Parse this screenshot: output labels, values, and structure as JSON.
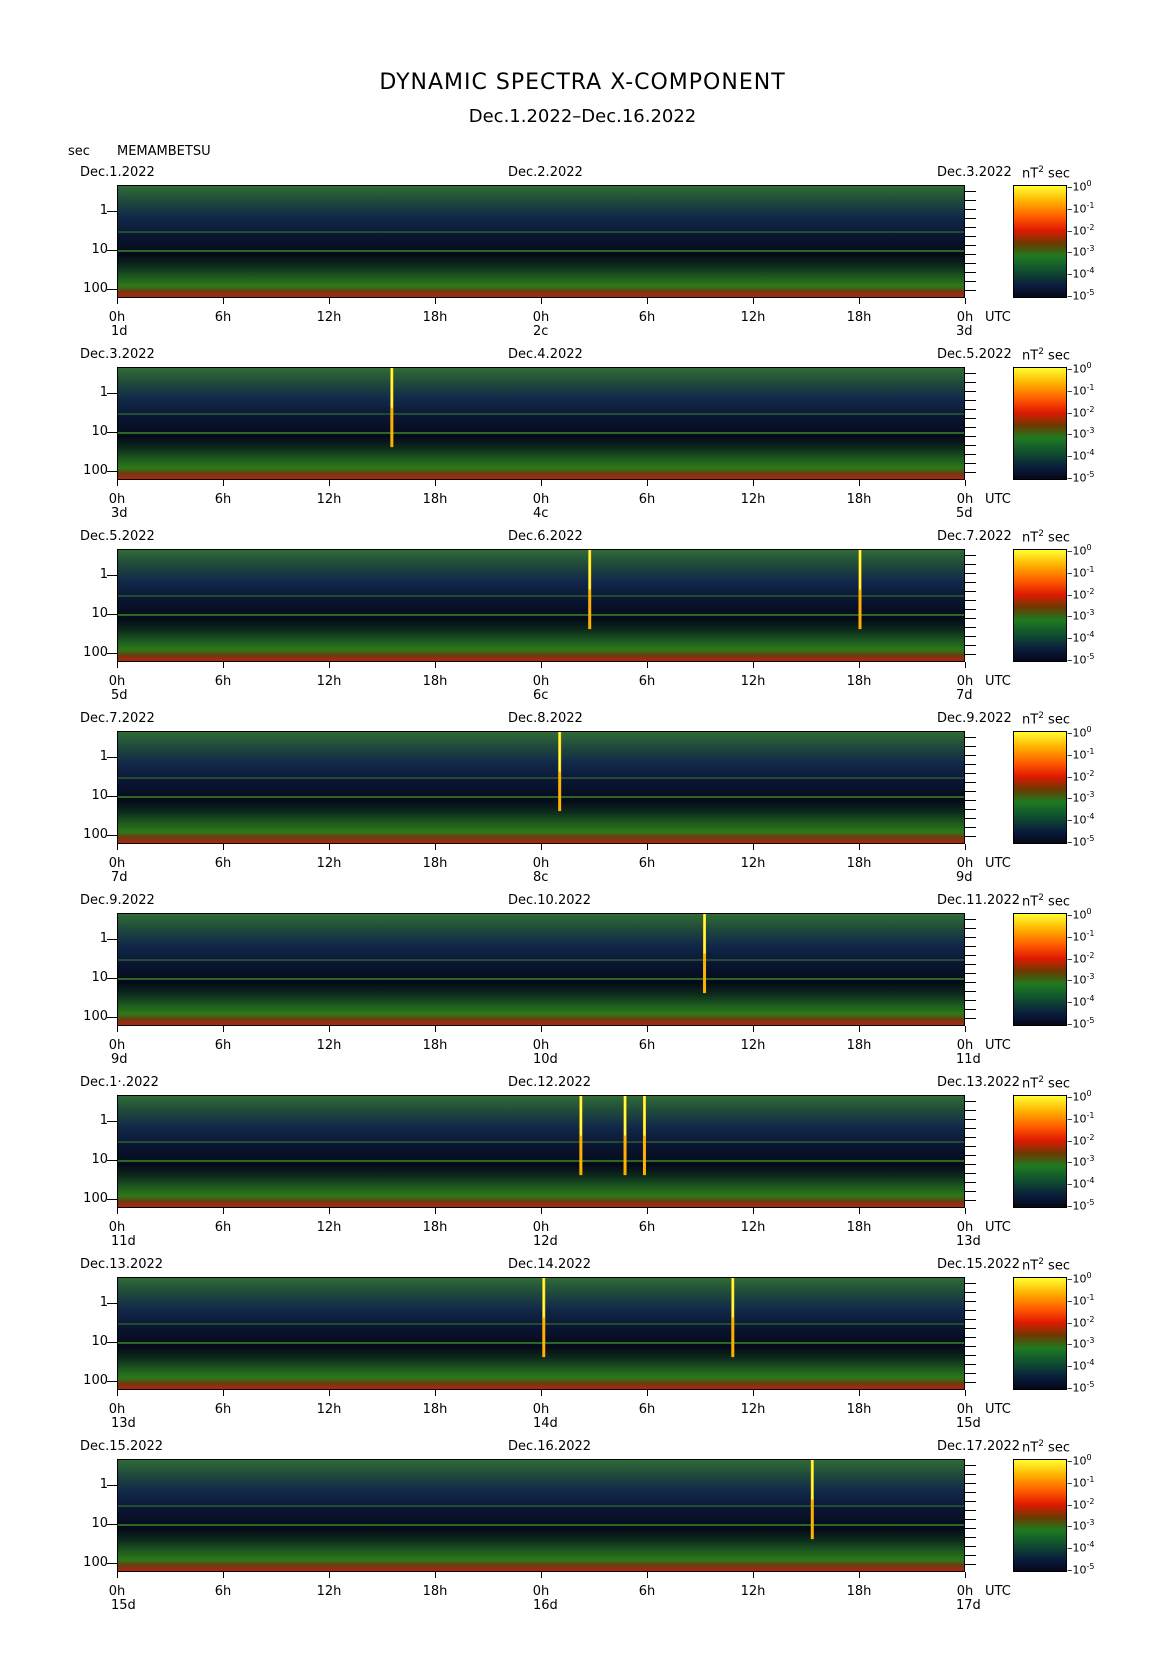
{
  "title": "DYNAMIC SPECTRA X-COMPONENT",
  "subtitle": "Dec.1.2022–Dec.16.2022",
  "header": {
    "yunit": "sec",
    "station": "MEMAMBETSU"
  },
  "colors": {
    "low": "#050818",
    "mid": "#1f7a1f",
    "high": "#e01a00",
    "max": "#ffff30"
  },
  "chart_data": {
    "type": "heatmap",
    "title": "DYNAMIC SPECTRA X-COMPONENT",
    "yaxis": {
      "label": "sec",
      "ticks": [
        "1",
        "10",
        "100"
      ],
      "scale": "log"
    },
    "xaxis": {
      "label": "UTC",
      "ticks": [
        "0h",
        "6h",
        "12h",
        "18h",
        "0h",
        "6h",
        "12h",
        "18h",
        "0h"
      ]
    },
    "colorbar": {
      "unit": "nT",
      "unit_exp": "2",
      "unit_suffix": "sec",
      "ticks": [
        {
          "base": "10",
          "exp": "0"
        },
        {
          "base": "10",
          "exp": "-1"
        },
        {
          "base": "10",
          "exp": "-2"
        },
        {
          "base": "10",
          "exp": "-3"
        },
        {
          "base": "10",
          "exp": "-4"
        },
        {
          "base": "10",
          "exp": "-5"
        }
      ]
    },
    "panels": [
      {
        "left_date": "Dec.1.2022",
        "mid_date": "Dec.2.2022",
        "right_date": "Dec.3.2022",
        "day_start": "1d",
        "day_mid": "2c",
        "day_end": "3d",
        "spikes_hours": []
      },
      {
        "left_date": "Dec.3.2022",
        "mid_date": "Dec.4.2022",
        "right_date": "Dec.5.2022",
        "day_start": "3d",
        "day_mid": "4c",
        "day_end": "5d",
        "spikes_hours": [
          15.5
        ]
      },
      {
        "left_date": "Dec.5.2022",
        "mid_date": "Dec.6.2022",
        "right_date": "Dec.7.2022",
        "day_start": "5d",
        "day_mid": "6c",
        "day_end": "7d",
        "spikes_hours": [
          26.7,
          42.0
        ]
      },
      {
        "left_date": "Dec.7.2022",
        "mid_date": "Dec.8.2022",
        "right_date": "Dec.9.2022",
        "day_start": "7d",
        "day_mid": "8c",
        "day_end": "9d",
        "spikes_hours": [
          25.0
        ]
      },
      {
        "left_date": "Dec.9.2022",
        "mid_date": "Dec.10.2022",
        "right_date": "Dec.11.2022",
        "day_start": "9d",
        "day_mid": "10d",
        "day_end": "11d",
        "spikes_hours": [
          33.2
        ]
      },
      {
        "left_date": "Dec.1·.2022",
        "mid_date": "Dec.12.2022",
        "right_date": "Dec.13.2022",
        "day_start": "11d",
        "day_mid": "12d",
        "day_end": "13d",
        "spikes_hours": [
          26.2,
          28.7,
          29.8
        ]
      },
      {
        "left_date": "Dec.13.2022",
        "mid_date": "Dec.14.2022",
        "right_date": "Dec.15.2022",
        "day_start": "13d",
        "day_mid": "14d",
        "day_end": "15d",
        "spikes_hours": [
          24.1,
          34.8
        ]
      },
      {
        "left_date": "Dec.15.2022",
        "mid_date": "Dec.16.2022",
        "right_date": "Dec.17.2022",
        "day_start": "15d",
        "day_mid": "16d",
        "day_end": "17d",
        "spikes_hours": [
          39.3
        ]
      }
    ]
  }
}
